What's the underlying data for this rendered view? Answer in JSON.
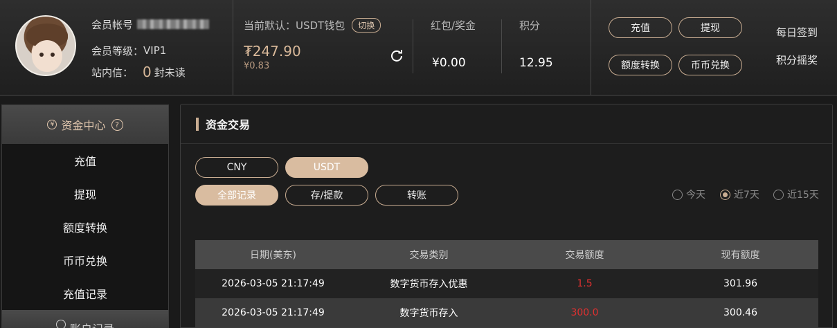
{
  "header": {
    "member_label": "会员帐号",
    "level_label": "会员等级：",
    "level_value": "VIP1",
    "inbox_label": "站内信：",
    "inbox_count": "0",
    "inbox_unit": "封未读",
    "wallet_title": "当前默认：USDT钱包",
    "switch_label": "切换",
    "wallet_amount": "₮247.90",
    "wallet_sub": "¥0.83",
    "bonus_label": "红包/奖金",
    "bonus_value": "¥0.00",
    "points_label": "积分",
    "points_value": "12.95",
    "btn_deposit": "充值",
    "btn_withdraw": "提现",
    "btn_transfer": "额度转换",
    "btn_exchange": "币币兑换",
    "daily_checkin": "每日签到",
    "points_lottery": "积分摇奖"
  },
  "sidebar": {
    "head_icon": "¥",
    "title": "资金中心",
    "help_icon": "?",
    "items": [
      {
        "label": "充值"
      },
      {
        "label": "提现"
      },
      {
        "label": "额度转换"
      },
      {
        "label": "币币兑换"
      },
      {
        "label": "充值记录"
      }
    ],
    "next_section": "账户记录"
  },
  "main": {
    "title": "资金交易",
    "currency_tabs": [
      {
        "label": "CNY",
        "active": false
      },
      {
        "label": "USDT",
        "active": true
      }
    ],
    "record_tabs": [
      {
        "label": "全部记录",
        "active": true
      },
      {
        "label": "存/提款",
        "active": false
      },
      {
        "label": "转账",
        "active": false
      }
    ],
    "date_filters": [
      {
        "label": "今天",
        "selected": false
      },
      {
        "label": "近7天",
        "selected": true
      },
      {
        "label": "近15天",
        "selected": false
      }
    ],
    "table": {
      "columns": [
        "日期(美东)",
        "交易类别",
        "交易额度",
        "现有额度"
      ],
      "rows": [
        [
          "2026-03-05 21:17:49",
          "数字货币存入优惠",
          "1.5",
          "301.96"
        ],
        [
          "2026-03-05 21:17:49",
          "数字货币存入",
          "300.0",
          "300.46"
        ]
      ]
    }
  }
}
